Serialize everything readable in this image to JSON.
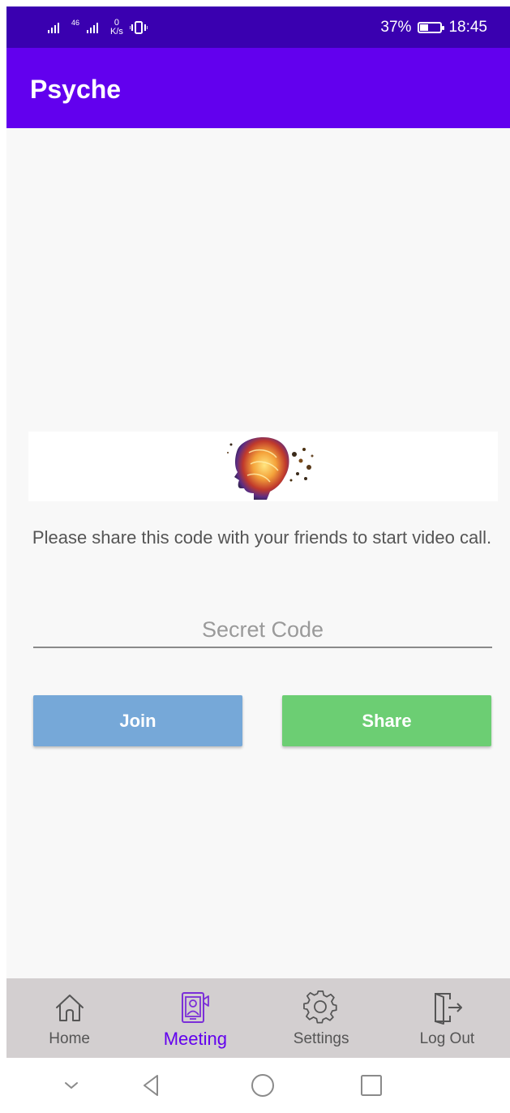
{
  "status_bar": {
    "signal_text": "46",
    "net_speed_value": "0",
    "net_speed_unit": "K/s",
    "battery_percent": "37%",
    "battery_level": 0.37,
    "time": "18:45"
  },
  "app_bar": {
    "title": "Psyche"
  },
  "content": {
    "instructions": "Please share this code with your friends to start video call.",
    "secret_code": {
      "value": "",
      "placeholder": "Secret Code"
    },
    "join_label": "Join",
    "share_label": "Share"
  },
  "bottom_nav": {
    "items": [
      {
        "label": "Home",
        "icon": "home-icon"
      },
      {
        "label": "Meeting",
        "icon": "meeting-icon"
      },
      {
        "label": "Settings",
        "icon": "gear-icon"
      },
      {
        "label": "Log Out",
        "icon": "logout-icon"
      }
    ],
    "active": "Meeting"
  },
  "colors": {
    "status_bar": "#3a00b0",
    "app_bar": "#6200ee",
    "join_button": "#76a8d8",
    "share_button": "#6cce73",
    "bottom_nav": "#d3cfd0",
    "accent": "#6200ee"
  }
}
